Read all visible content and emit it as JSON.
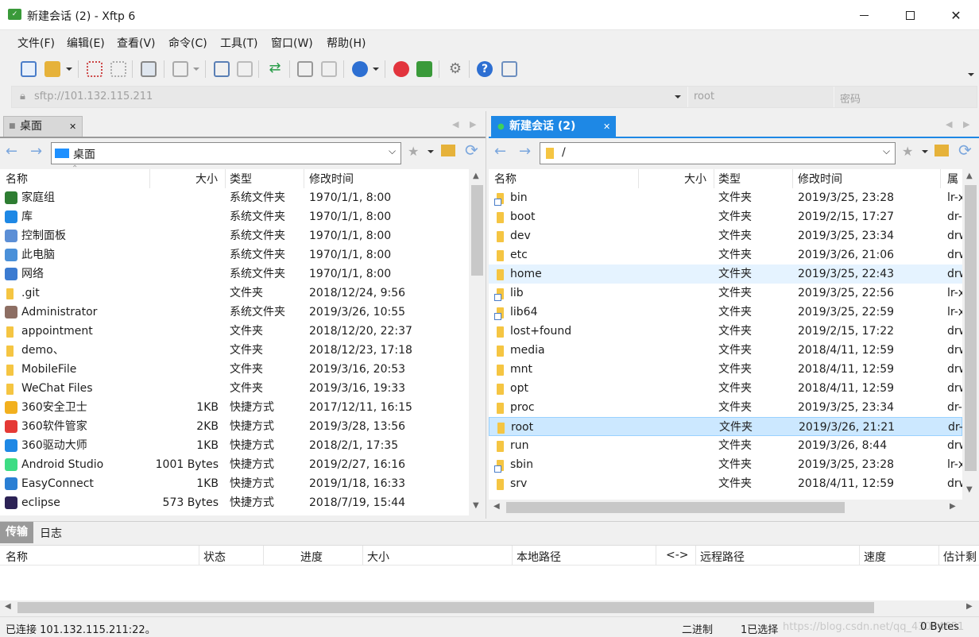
{
  "window": {
    "title": "新建会话 (2)   - Xftp 6",
    "minimize": "—",
    "maximize": "☐",
    "close": "✕"
  },
  "menu": [
    "文件(F)",
    "编辑(E)",
    "查看(V)",
    "命令(C)",
    "工具(T)",
    "窗口(W)",
    "帮助(H)"
  ],
  "address": {
    "url": "sftp://101.132.115.211",
    "user_placeholder": "root",
    "password_placeholder": "密码"
  },
  "left_panel": {
    "tab_label": "桌面",
    "path": "桌面",
    "columns": [
      "名称",
      "大小",
      "类型",
      "修改时间"
    ],
    "rows": [
      {
        "name": "家庭组",
        "size": "",
        "type": "系统文件夹",
        "modified": "1970/1/1, 8:00",
        "icon": "homegroup-icon"
      },
      {
        "name": "库",
        "size": "",
        "type": "系统文件夹",
        "modified": "1970/1/1, 8:00",
        "icon": "library-icon"
      },
      {
        "name": "控制面板",
        "size": "",
        "type": "系统文件夹",
        "modified": "1970/1/1, 8:00",
        "icon": "control-panel-icon"
      },
      {
        "name": "此电脑",
        "size": "",
        "type": "系统文件夹",
        "modified": "1970/1/1, 8:00",
        "icon": "computer-icon"
      },
      {
        "name": "网络",
        "size": "",
        "type": "系统文件夹",
        "modified": "1970/1/1, 8:00",
        "icon": "network-icon"
      },
      {
        "name": ".git",
        "size": "",
        "type": "文件夹",
        "modified": "2018/12/24, 9:56",
        "icon": "folder-icon"
      },
      {
        "name": "Administrator",
        "size": "",
        "type": "系统文件夹",
        "modified": "2019/3/26, 10:55",
        "icon": "user-folder-icon"
      },
      {
        "name": "appointment",
        "size": "",
        "type": "文件夹",
        "modified": "2018/12/20, 22:37",
        "icon": "folder-icon"
      },
      {
        "name": "demo、",
        "size": "",
        "type": "文件夹",
        "modified": "2018/12/23, 17:18",
        "icon": "folder-icon"
      },
      {
        "name": "MobileFile",
        "size": "",
        "type": "文件夹",
        "modified": "2019/3/16, 20:53",
        "icon": "folder-icon"
      },
      {
        "name": "WeChat Files",
        "size": "",
        "type": "文件夹",
        "modified": "2019/3/16, 19:33",
        "icon": "folder-icon"
      },
      {
        "name": "360安全卫士",
        "size": "1KB",
        "type": "快捷方式",
        "modified": "2017/12/11, 16:15",
        "icon": "360-safe-icon"
      },
      {
        "name": "360软件管家",
        "size": "2KB",
        "type": "快捷方式",
        "modified": "2019/3/28, 13:56",
        "icon": "360-software-icon"
      },
      {
        "name": "360驱动大师",
        "size": "1KB",
        "type": "快捷方式",
        "modified": "2018/2/1, 17:35",
        "icon": "360-driver-icon"
      },
      {
        "name": "Android Studio",
        "size": "1001 Bytes",
        "type": "快捷方式",
        "modified": "2019/2/27, 16:16",
        "icon": "android-studio-icon"
      },
      {
        "name": "EasyConnect",
        "size": "1KB",
        "type": "快捷方式",
        "modified": "2019/1/18, 16:33",
        "icon": "easyconnect-icon"
      },
      {
        "name": "eclipse",
        "size": "573 Bytes",
        "type": "快捷方式",
        "modified": "2018/7/19, 15:44",
        "icon": "eclipse-icon"
      }
    ]
  },
  "right_panel": {
    "tab_label": "新建会话 (2)",
    "path": "/",
    "columns": [
      "名称",
      "大小",
      "类型",
      "修改时间",
      "属性"
    ],
    "rows": [
      {
        "name": "bin",
        "type": "文件夹",
        "modified": "2019/3/25, 23:28",
        "attr": "lr-x",
        "link": true
      },
      {
        "name": "boot",
        "type": "文件夹",
        "modified": "2019/2/15, 17:27",
        "attr": "dr-",
        "link": false
      },
      {
        "name": "dev",
        "type": "文件夹",
        "modified": "2019/3/25, 23:34",
        "attr": "drw",
        "link": false
      },
      {
        "name": "etc",
        "type": "文件夹",
        "modified": "2019/3/26, 21:06",
        "attr": "drw",
        "link": false
      },
      {
        "name": "home",
        "type": "文件夹",
        "modified": "2019/3/25, 22:43",
        "attr": "drw",
        "link": false
      },
      {
        "name": "lib",
        "type": "文件夹",
        "modified": "2019/3/25, 22:56",
        "attr": "lr-x",
        "link": true
      },
      {
        "name": "lib64",
        "type": "文件夹",
        "modified": "2019/3/25, 22:59",
        "attr": "lr-x",
        "link": true
      },
      {
        "name": "lost+found",
        "type": "文件夹",
        "modified": "2019/2/15, 17:22",
        "attr": "drw",
        "link": false
      },
      {
        "name": "media",
        "type": "文件夹",
        "modified": "2018/4/11, 12:59",
        "attr": "drw",
        "link": false
      },
      {
        "name": "mnt",
        "type": "文件夹",
        "modified": "2018/4/11, 12:59",
        "attr": "drw",
        "link": false
      },
      {
        "name": "opt",
        "type": "文件夹",
        "modified": "2018/4/11, 12:59",
        "attr": "drw",
        "link": false
      },
      {
        "name": "proc",
        "type": "文件夹",
        "modified": "2019/3/25, 23:34",
        "attr": "dr-",
        "link": false
      },
      {
        "name": "root",
        "type": "文件夹",
        "modified": "2019/3/26, 21:21",
        "attr": "dr-",
        "link": false
      },
      {
        "name": "run",
        "type": "文件夹",
        "modified": "2019/3/26, 8:44",
        "attr": "drw",
        "link": false
      },
      {
        "name": "sbin",
        "type": "文件夹",
        "modified": "2019/3/25, 23:28",
        "attr": "lr-x",
        "link": true
      },
      {
        "name": "srv",
        "type": "文件夹",
        "modified": "2018/4/11, 12:59",
        "attr": "drw",
        "link": false
      }
    ],
    "selected_row": 12,
    "hover_row": 4
  },
  "bottom": {
    "tabs": [
      "传输",
      "日志"
    ],
    "columns": [
      "名称",
      "状态",
      "进度",
      "大小",
      "本地路径",
      "<->",
      "远程路径",
      "速度",
      "估计剩"
    ]
  },
  "status": {
    "connected": "已连接 101.132.115.211:22。",
    "mode": "二进制",
    "selection": "1已选择",
    "size": "0 Bytes",
    "watermark": "https://blog.csdn.net/qq_43084651"
  }
}
